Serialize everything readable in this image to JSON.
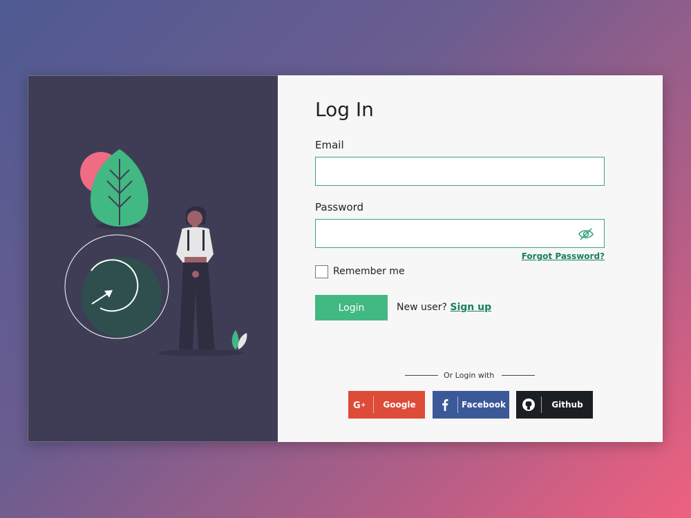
{
  "login": {
    "title": "Log In",
    "email_label": "Email",
    "email_value": "",
    "password_label": "Password",
    "password_value": "",
    "forgot_label": "Forgot Password?",
    "remember_label": "Remember me",
    "login_button": "Login",
    "new_user_text": "New user?",
    "signup_link": "Sign up",
    "or_text": "Or Login with"
  },
  "social": [
    {
      "label": "Google",
      "icon": "google-plus-icon",
      "color": "#dd4b39"
    },
    {
      "label": "Facebook",
      "icon": "facebook-icon",
      "color": "#3b5998"
    },
    {
      "label": "Github",
      "icon": "github-icon",
      "color": "#1b1f23"
    }
  ],
  "colors": {
    "accent": "#42b883",
    "link": "#1a7f5a",
    "illustration_bg": "#3f3d56",
    "form_bg": "#f7f7f7"
  }
}
